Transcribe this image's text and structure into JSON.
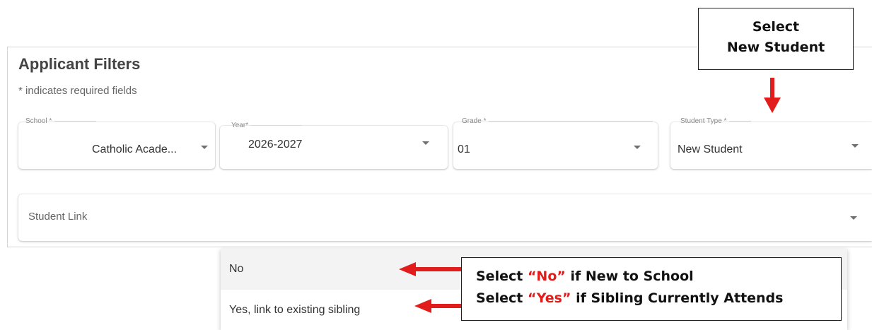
{
  "panel": {
    "title": "Applicant Filters",
    "required_note": "* indicates required fields"
  },
  "fields": {
    "school": {
      "label": "School *",
      "value": "Catholic Acade..."
    },
    "year": {
      "label": "Year*",
      "value": "2026-2027"
    },
    "grade": {
      "label": "Grade *",
      "value": "01"
    },
    "student_type": {
      "label": "Student Type *",
      "value": "New Student"
    },
    "student_link": {
      "placeholder": "Student Link"
    }
  },
  "dropdown": {
    "options": [
      "No",
      "Yes, link to existing sibling"
    ]
  },
  "callouts": {
    "top": {
      "line1": "Select",
      "line2": "New Student"
    },
    "bottom": {
      "line1_prefix": "Select ",
      "line1_highlight": "“No”",
      "line1_suffix": " if New to School",
      "line2_prefix": "Select ",
      "line2_highlight": "“Yes”",
      "line2_suffix": " if Sibling Currently Attends"
    }
  },
  "colors": {
    "arrow": "#e21b1b",
    "highlight_text": "#e21b1b",
    "selected_option_bg": "#f3f3f3"
  },
  "icons": [
    "chevron-down-icon",
    "red-arrow-down",
    "red-arrow-left"
  ]
}
